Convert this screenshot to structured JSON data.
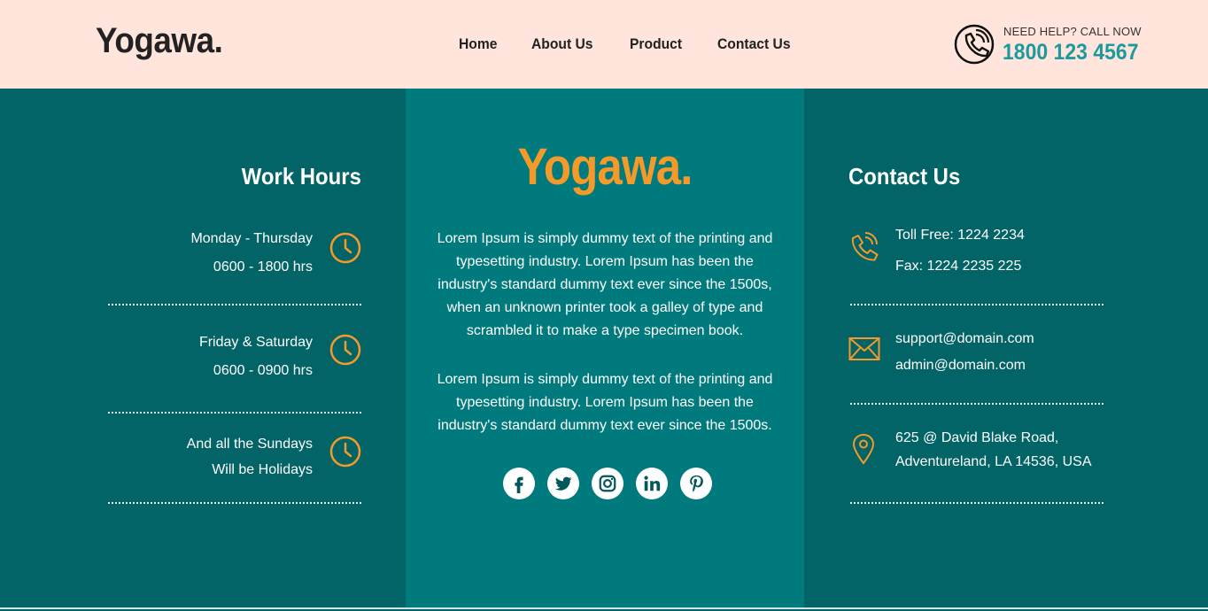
{
  "header": {
    "logo": "Yogawa.",
    "nav": [
      "Home",
      "About Us",
      "Product",
      "Contact Us"
    ],
    "help_label": "NEED HELP? CALL NOW",
    "help_number": "1800 123 4567"
  },
  "work_hours": {
    "title": "Work Hours",
    "items": [
      {
        "line1": "Monday - Thursday",
        "line2": "0600 - 1800 hrs"
      },
      {
        "line1": "Friday & Saturday",
        "line2": "0600 - 0900 hrs"
      },
      {
        "line1": "And all the Sundays",
        "line2": "Will be Holidays"
      }
    ]
  },
  "about": {
    "logo": "Yogawa.",
    "para1": "Lorem Ipsum is simply dummy text of the printing and typesetting industry. Lorem Ipsum has been the industry's standard dummy text ever since the 1500s, when an unknown printer took a galley of type and scrambled it to make a type specimen book.",
    "para2": "Lorem Ipsum is simply dummy text of the printing and typesetting industry. Lorem Ipsum has been the industry's standard dummy text ever since the 1500s.",
    "socials": [
      "facebook-icon",
      "twitter-icon",
      "instagram-icon",
      "linkedin-icon",
      "pinterest-icon"
    ]
  },
  "contact": {
    "title": "Contact Us",
    "toll_free": "Toll Free: 1224 2234",
    "fax": "Fax: 1224 2235 225",
    "email1": "support@domain.com",
    "email2": "admin@domain.com",
    "address1": "625 @ David Blake Road,",
    "address2": "Adventureland, LA 14536, USA"
  },
  "colors": {
    "header_bg": "#ffe5dc",
    "side_bg": "#026466",
    "mid_bg": "#017a7e",
    "accent": "#f39a2b",
    "phone_accent": "#1c9a9c"
  }
}
